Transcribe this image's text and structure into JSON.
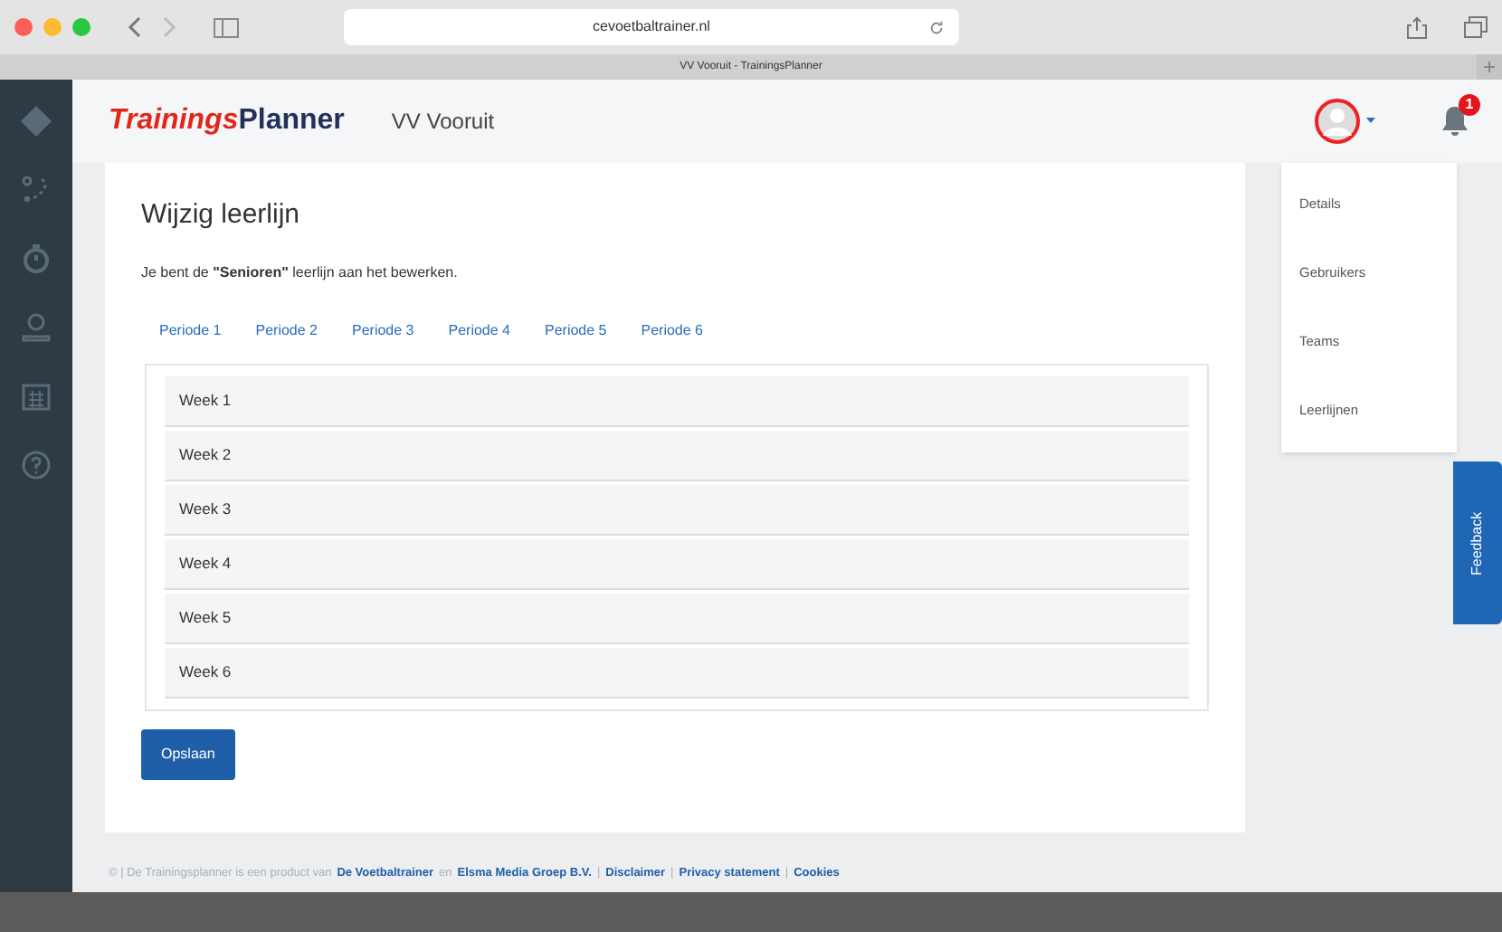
{
  "browser": {
    "url": "cevoetbaltrainer.nl",
    "tab_title": "VV Vooruit - TrainingsPlanner"
  },
  "header": {
    "logo_part1": "Trainings",
    "logo_part2": "Planner",
    "club": "VV Vooruit",
    "notification_count": "1"
  },
  "page": {
    "title": "Wijzig leerlijn",
    "intro": "Je bent de **\"Senioren\"** leerlijn aan het bewerken.",
    "tabs": [
      "Periode 1",
      "Periode 2",
      "Periode 3",
      "Periode 4",
      "Periode 5",
      "Periode 6"
    ],
    "weeks": [
      "Week 1",
      "Week 2",
      "Week 3",
      "Week 4",
      "Week 5",
      "Week 6"
    ],
    "save_button": "Opslaan"
  },
  "user_menu": {
    "items": [
      "Details",
      "Gebruikers",
      "Teams",
      "Leerlijnen"
    ]
  },
  "feedback": "Feedback",
  "footer": [
    {
      "kind": "text",
      "text": "© | De Trainingsplanner is een product van"
    },
    {
      "kind": "link",
      "text": "De Voetbaltrainer"
    },
    {
      "kind": "text",
      "text": "en"
    },
    {
      "kind": "link",
      "text": "Elsma Media Groep B.V."
    },
    {
      "kind": "text",
      "text": "|"
    },
    {
      "kind": "link",
      "text": "Disclaimer"
    },
    {
      "kind": "text",
      "text": "|"
    },
    {
      "kind": "link",
      "text": "Privacy statement"
    },
    {
      "kind": "text",
      "text": "|"
    },
    {
      "kind": "link",
      "text": "Cookies"
    }
  ]
}
